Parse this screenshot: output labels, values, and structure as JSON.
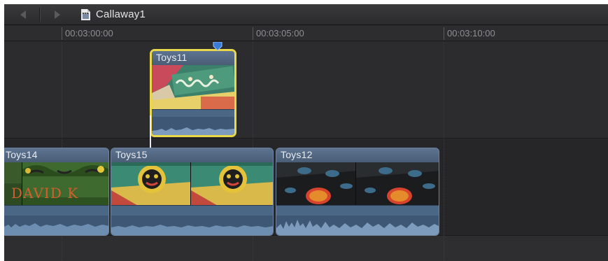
{
  "header": {
    "back_icon": "chevron-left-icon",
    "forward_icon": "chevron-right-icon",
    "project_icon": "project-clapper-icon",
    "project_title": "Callaway1"
  },
  "ruler": {
    "timecodes": [
      "00:03:00:00",
      "00:03:05:00",
      "00:03:10:00"
    ]
  },
  "clips": {
    "connected": {
      "name": "Toys11",
      "selected": true
    },
    "primary": [
      {
        "name": "Toys14"
      },
      {
        "name": "Toys15"
      },
      {
        "name": "Toys12"
      }
    ],
    "thumb_text": "DAVID K"
  },
  "colors": {
    "background": "#2a2a2c",
    "clip_body": "#4d6079",
    "selection": "#e9d84a",
    "playhead_marker": "#3a7bd5"
  }
}
